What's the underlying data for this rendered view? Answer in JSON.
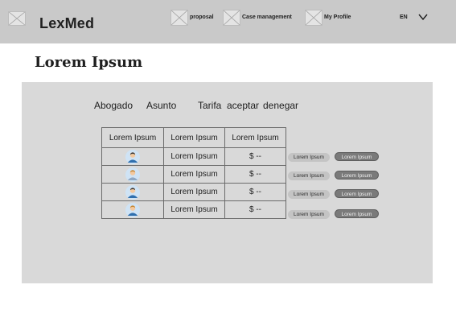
{
  "header": {
    "brand": "LexMed",
    "nav": [
      {
        "label": "proposal"
      },
      {
        "label": "Case management"
      },
      {
        "label": "My Profile"
      }
    ],
    "language": "EN"
  },
  "page": {
    "title": "Lorem Ipsum"
  },
  "filters": [
    "Abogado",
    "Asunto",
    "Tarifa",
    "aceptar",
    "denegar"
  ],
  "table": {
    "headers": [
      "Lorem Ipsum",
      "Lorem Ipsum",
      "Lorem Ipsum"
    ],
    "rows": [
      {
        "name": "Lorem Ipsum",
        "fee": "$ --",
        "accept": "Lorem Ipsum",
        "deny": "Lorem Ipsum"
      },
      {
        "name": "Lorem Ipsum",
        "fee": "$ --",
        "accept": "Lorem Ipsum",
        "deny": "Lorem Ipsum"
      },
      {
        "name": "Lorem Ipsum",
        "fee": "$ --",
        "accept": "Lorem Ipsum",
        "deny": "Lorem Ipsum"
      },
      {
        "name": "Lorem Ipsum",
        "fee": "$ --",
        "accept": "Lorem Ipsum",
        "deny": "Lorem Ipsum"
      }
    ]
  },
  "icons": {
    "logo": "image-placeholder-icon",
    "nav": "image-placeholder-icon",
    "language_menu": "chevron-down-icon",
    "row_avatar": "user-avatar-icon"
  },
  "colors": {
    "topbar": "#c9c9c9",
    "panel": "#d9d9d9",
    "accept_button": "#c4c4c4",
    "deny_button": "#7a7a7a"
  }
}
